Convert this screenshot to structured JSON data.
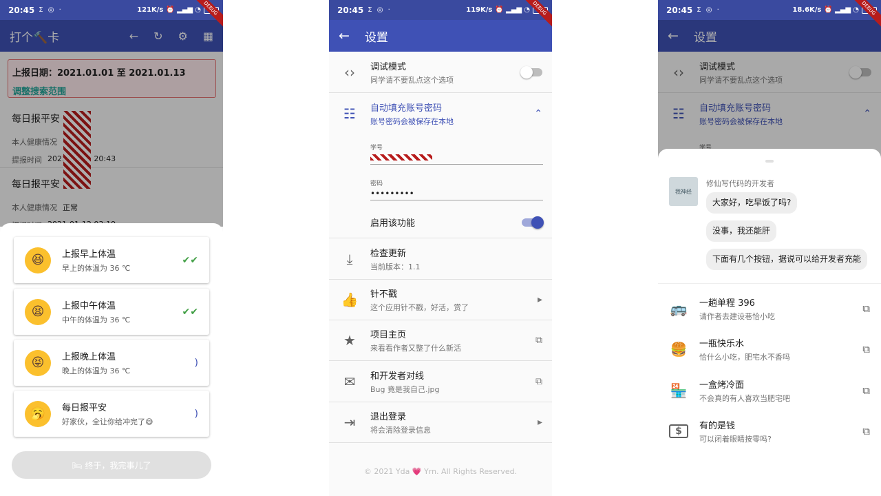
{
  "status_left": {
    "time": "20:45",
    "icons": "Σ ◎ ·"
  },
  "panel1": {
    "status_speed": "121K/s",
    "battery": "57",
    "debug": "DEBUG",
    "title": "打个🔨卡",
    "date_range": "上报日期：2021.01.01 至 2021.01.13",
    "adjust_link": "调整搜索范围",
    "records": [
      {
        "title": "每日报平安",
        "health_label": "本人健康情况",
        "health_value": "",
        "time_label": "提报时间",
        "time_value": "2021-01-13 20:43"
      },
      {
        "title": "每日报平安",
        "health_label": "本人健康情况",
        "health_value": "正常",
        "time_label": "提报时间",
        "time_value": "2021-01-12 03:19"
      }
    ],
    "tasks": [
      {
        "face": "😆",
        "title": "上报早上体温",
        "subtitle": "早上的体温为 36 ℃",
        "status": "✔✔",
        "state": "done"
      },
      {
        "face": "😫",
        "title": "上报中午体温",
        "subtitle": "中午的体温为 36 ℃",
        "status": "✔✔",
        "state": "done"
      },
      {
        "face": "😝",
        "title": "上报晚上体温",
        "subtitle": "晚上的体温为 36 ℃",
        "status": ")",
        "state": "load"
      },
      {
        "face": "🥱",
        "title": "每日报平安",
        "subtitle": "好家伙，全让你给冲完了😅",
        "status": ")",
        "state": "load"
      }
    ],
    "done_button": "🛏 终于，我完事儿了"
  },
  "panel2": {
    "status_speed": "119K/s",
    "title": "设置",
    "debug_mode": {
      "title": "调试模式",
      "subtitle": "同学请不要乱点这个选项",
      "on": false
    },
    "autofill": {
      "title": "自动填充账号密码",
      "subtitle": "账号密码会被保存在本地"
    },
    "student_id_label": "学号",
    "password_label": "密码",
    "password_value": "•••••••••",
    "enable_label": "启用该功能",
    "items": [
      {
        "icon": "⤓",
        "title": "检查更新",
        "subtitle": "当前版本：1.1",
        "tail": ""
      },
      {
        "icon": "👍",
        "title": "针不戳",
        "subtitle": "这个应用针不戳，好活，赏了",
        "tail": "▸"
      },
      {
        "icon": "★",
        "title": "项目主页",
        "subtitle": "来看看作者又整了什么新活",
        "tail": "⧉"
      },
      {
        "icon": "✉",
        "title": "和开发者对线",
        "subtitle": "Bug 竟是我自己.jpg",
        "tail": "⧉"
      },
      {
        "icon": "⇥",
        "title": "退出登录",
        "subtitle": "将会清除登录信息",
        "tail": "▸"
      }
    ],
    "footer": "© 2021 Yda 💗 Yrn. All Rights Reserved."
  },
  "panel3": {
    "status_speed": "18.6K/s",
    "dev_avatar_text": "我神经",
    "dev_name": "修仙写代码的开发者",
    "messages": [
      "大家好，吃早饭了吗?",
      "没事，我还能肝",
      "下面有几个按钮，据说可以给开发者充能"
    ],
    "donations": [
      {
        "icon": "🚌",
        "title": "一趟单程 396",
        "subtitle": "请作者去建设巷恰小吃"
      },
      {
        "icon": "🍔",
        "title": "一瓶快乐水",
        "subtitle": "恰什么小吃，肥宅水不香吗"
      },
      {
        "icon": "🏪",
        "title": "一盒烤冷面",
        "subtitle": "不会真的有人喜欢当肥宅吧"
      },
      {
        "icon": "$",
        "title": "有的是钱",
        "subtitle": "可以闭着眼睛按零吗?"
      }
    ],
    "ext_icon": "⧉"
  }
}
